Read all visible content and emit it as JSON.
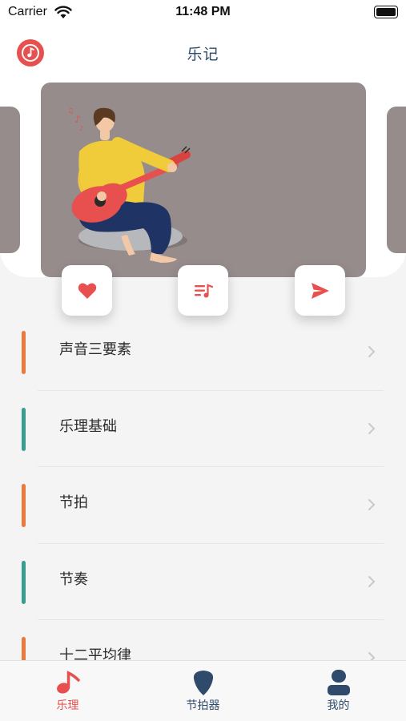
{
  "status_bar": {
    "carrier": "Carrier",
    "time": "11:48 PM"
  },
  "header": {
    "title": "乐记"
  },
  "banner": {
    "image": "guitar-player-illustration"
  },
  "actions": {
    "like": {
      "icon": "heart-icon"
    },
    "playlist": {
      "icon": "playlist-music-icon"
    },
    "share": {
      "icon": "send-icon"
    }
  },
  "topics": [
    {
      "label": "声音三要素",
      "accent": "#e8793f"
    },
    {
      "label": "乐理基础",
      "accent": "#3a9c8e"
    },
    {
      "label": "节拍",
      "accent": "#e8793f"
    },
    {
      "label": "节奏",
      "accent": "#3a9c8e"
    },
    {
      "label": "十二平均律",
      "accent": "#e8793f"
    }
  ],
  "tab_bar": {
    "tabs": [
      {
        "label": "乐理",
        "icon": "music-note-icon",
        "active": true
      },
      {
        "label": "节拍器",
        "icon": "guitar-pick-icon",
        "active": false
      },
      {
        "label": "我的",
        "icon": "user-icon",
        "active": false
      }
    ]
  },
  "colors": {
    "accent": "#e8504f",
    "title": "#2f4a6b",
    "tab_inactive": "#2f4a6b",
    "banner_bg": "#958c8b"
  }
}
